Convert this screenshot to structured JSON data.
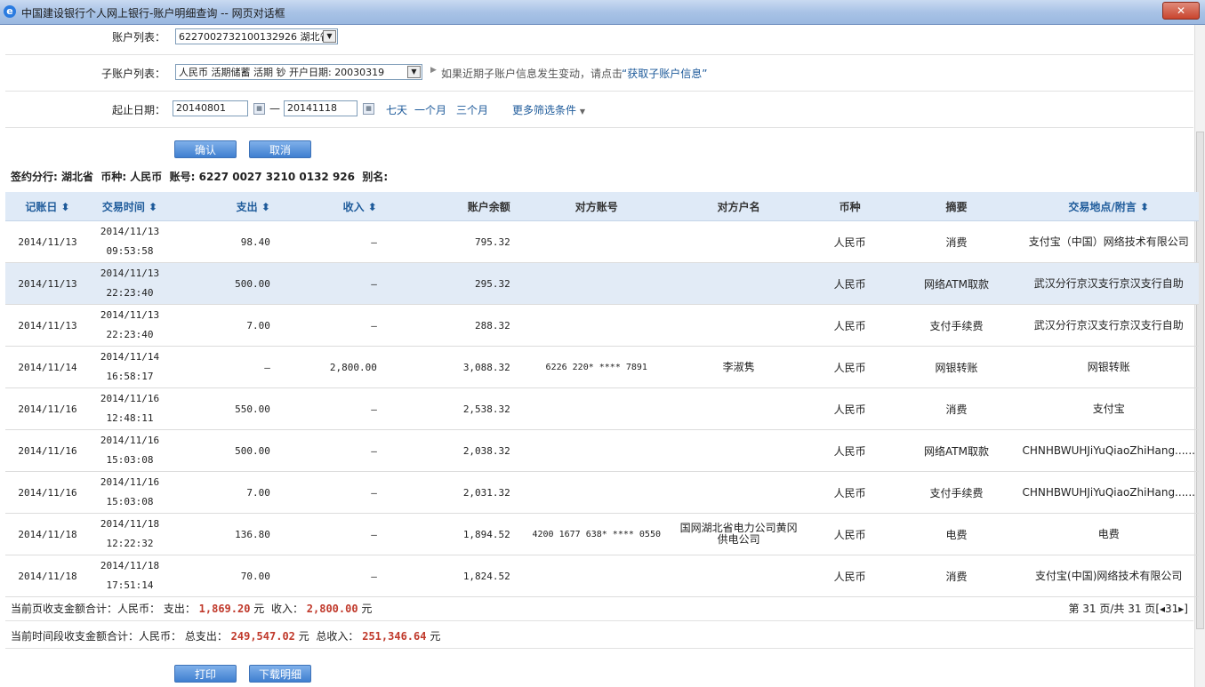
{
  "window": {
    "title": "中国建设银行个人网上银行-账户明细查询 -- 网页对话框",
    "close_label": "✕"
  },
  "account": {
    "label": "账户列表：",
    "value": "6227002732100132926 湖北省"
  },
  "subaccount": {
    "label": "子账户列表：",
    "value": "人民币 活期储蓄 活期 钞 开户日期: 20030319",
    "hint": "如果近期子账户信息发生变动，请点击",
    "link": "“获取子账户信息”"
  },
  "dates": {
    "label": "起止日期：",
    "start": "20140801",
    "sep": "—",
    "end": "20141118",
    "quick": [
      "七天",
      "一个月",
      "三个月"
    ],
    "more": "更多筛选条件"
  },
  "buttons": {
    "confirm": "确认",
    "cancel": "取消",
    "print": "打印",
    "download": "下载明细"
  },
  "info": {
    "text": "签约分行: 湖北省  币种: 人民币  账号: 6227 0027 3210 0132 926  别名:"
  },
  "table": {
    "headers": [
      "记账日",
      "交易时间",
      "支出",
      "收入",
      "账户余额",
      "对方账号",
      "对方户名",
      "币种",
      "摘要",
      "交易地点/附言"
    ],
    "rows": [
      {
        "date": "2014/11/13",
        "time1": "2014/11/13",
        "time2": "09:53:58",
        "out": "98.40",
        "in": "—",
        "bal": "795.32",
        "acct": "",
        "name": "",
        "cur": "人民币",
        "memo": "消费",
        "place": "支付宝（中国）网络技术有限公司"
      },
      {
        "date": "2014/11/13",
        "time1": "2014/11/13",
        "time2": "22:23:40",
        "out": "500.00",
        "in": "—",
        "bal": "295.32",
        "acct": "",
        "name": "",
        "cur": "人民币",
        "memo": "网络ATM取款",
        "place": "武汉分行京汉支行京汉支行自助"
      },
      {
        "date": "2014/11/13",
        "time1": "2014/11/13",
        "time2": "22:23:40",
        "out": "7.00",
        "in": "—",
        "bal": "288.32",
        "acct": "",
        "name": "",
        "cur": "人民币",
        "memo": "支付手续费",
        "place": "武汉分行京汉支行京汉支行自助"
      },
      {
        "date": "2014/11/14",
        "time1": "2014/11/14",
        "time2": "16:58:17",
        "out": "—",
        "in": "2,800.00",
        "bal": "3,088.32",
        "acct": "6226 220* **** 7891",
        "name": "李淑隽",
        "cur": "人民币",
        "memo": "网银转账",
        "place": "网银转账"
      },
      {
        "date": "2014/11/16",
        "time1": "2014/11/16",
        "time2": "12:48:11",
        "out": "550.00",
        "in": "—",
        "bal": "2,538.32",
        "acct": "",
        "name": "",
        "cur": "人民币",
        "memo": "消费",
        "place": "支付宝"
      },
      {
        "date": "2014/11/16",
        "time1": "2014/11/16",
        "time2": "15:03:08",
        "out": "500.00",
        "in": "—",
        "bal": "2,038.32",
        "acct": "",
        "name": "",
        "cur": "人民币",
        "memo": "网络ATM取款",
        "place": "CHNHBWUHJiYuQiaoZhiHang......"
      },
      {
        "date": "2014/11/16",
        "time1": "2014/11/16",
        "time2": "15:03:08",
        "out": "7.00",
        "in": "—",
        "bal": "2,031.32",
        "acct": "",
        "name": "",
        "cur": "人民币",
        "memo": "支付手续费",
        "place": "CHNHBWUHJiYuQiaoZhiHang......"
      },
      {
        "date": "2014/11/18",
        "time1": "2014/11/18",
        "time2": "12:22:32",
        "out": "136.80",
        "in": "—",
        "bal": "1,894.52",
        "acct": "4200 1677 638* **** 0550",
        "name": "国网湖北省电力公司黄冈供电公司",
        "cur": "人民币",
        "memo": "电费",
        "place": "电费"
      },
      {
        "date": "2014/11/18",
        "time1": "2014/11/18",
        "time2": "17:51:14",
        "out": "70.00",
        "in": "—",
        "bal": "1,824.52",
        "acct": "",
        "name": "",
        "cur": "人民币",
        "memo": "消费",
        "place": "支付宝(中国)网络技术有限公司"
      }
    ]
  },
  "summary": {
    "page_label": "当前页收支金额合计：人民币：  支出：",
    "page_out": "1,869.20",
    "yuan": "元",
    "page_in_label": "收入：",
    "page_in": "2,800.00",
    "period_label": "当前时间段收支金额合计：人民币：  总支出：",
    "period_out": "249,547.02",
    "period_in_label": "总收入：",
    "period_in": "251,346.64",
    "pager": "第 31 页/共 31 页",
    "pager_ctrl": "[◂31▸]"
  },
  "colors": {
    "accent": "#1d5a9a",
    "header_bg": "#dfeaf7",
    "highlight": "#e2ebf6",
    "amount_red": "#c0392b"
  }
}
